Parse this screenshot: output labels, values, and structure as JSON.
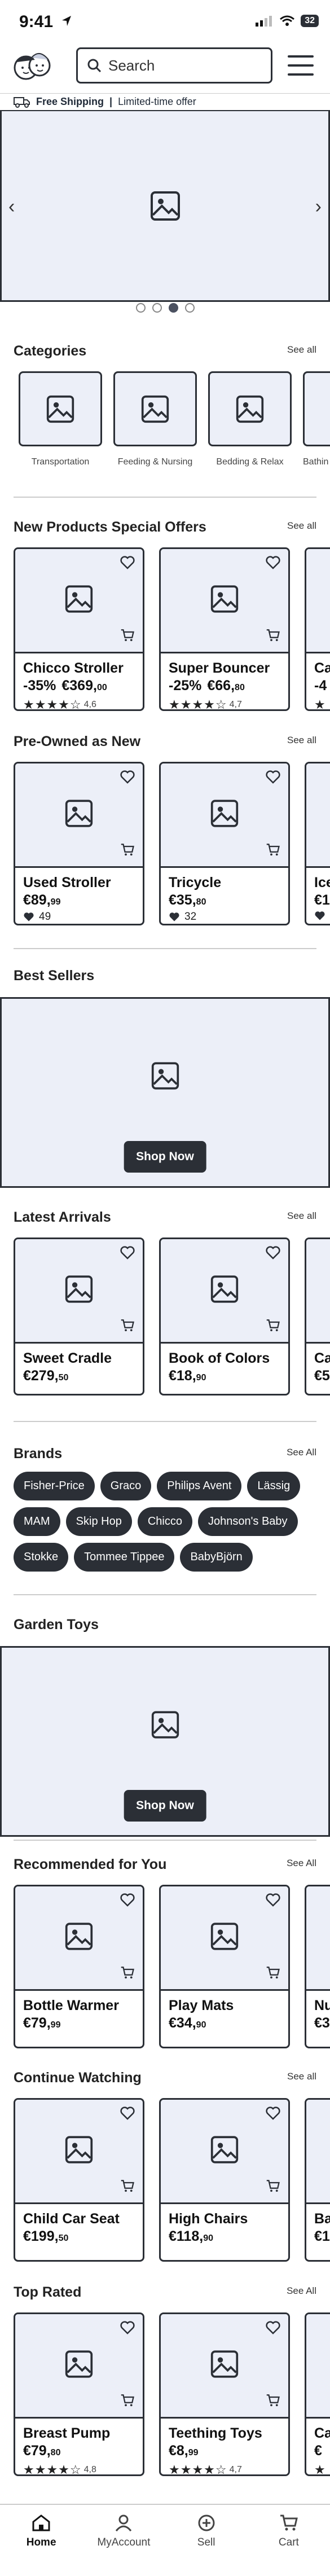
{
  "status_bar": {
    "time": "9:41",
    "battery": "32"
  },
  "header": {
    "search_placeholder": "Search"
  },
  "shipping": {
    "bold": "Free Shipping",
    "separator": "|",
    "text": "Limited-time offer"
  },
  "hero": {
    "slides_count": 4,
    "active_slide_index": 2,
    "prev": "‹",
    "next": "›"
  },
  "categories": {
    "title": "Categories",
    "see_all": "See all",
    "items": [
      {
        "label": "Transportation"
      },
      {
        "label": "Feeding & Nursing"
      },
      {
        "label": "Bedding & Relax"
      },
      {
        "label": "Bathin"
      }
    ]
  },
  "new_products": {
    "title": "New Products Special Offers",
    "see_all": "See all",
    "items": [
      {
        "name": "Chicco Stroller",
        "discount": "-35%",
        "price_main": "€369,",
        "price_cents": "00",
        "rating": "4,6",
        "stars": "★★★★☆"
      },
      {
        "name": "Super Bouncer",
        "discount": "-25%",
        "price_main": "€66,",
        "price_cents": "80",
        "rating": "4,7",
        "stars": "★★★★☆"
      },
      {
        "name": "Ca",
        "discount": "-4",
        "price_main": "",
        "price_cents": "",
        "rating": "",
        "stars": "★"
      }
    ]
  },
  "pre_owned": {
    "title": "Pre-Owned as New",
    "see_all": "See all",
    "items": [
      {
        "name": "Used Stroller",
        "price_main": "€89,",
        "price_cents": "99",
        "likes": "49"
      },
      {
        "name": "Tricycle",
        "price_main": "€35,",
        "price_cents": "80",
        "likes": "32"
      },
      {
        "name": "Ice",
        "price_main": "€1",
        "price_cents": "",
        "likes": ""
      }
    ]
  },
  "best_sellers": {
    "title": "Best Sellers",
    "cta": "Shop Now"
  },
  "latest_arrivals": {
    "title": "Latest Arrivals",
    "see_all": "See all",
    "items": [
      {
        "name": "Sweet Cradle",
        "price_main": "€279,",
        "price_cents": "50"
      },
      {
        "name": "Book of Colors",
        "price_main": "€18,",
        "price_cents": "90"
      },
      {
        "name": "Ca",
        "price_main": "€5",
        "price_cents": ""
      }
    ]
  },
  "brands": {
    "title": "Brands",
    "see_all": "See All",
    "items": [
      "Fisher-Price",
      "Graco",
      "Philips Avent",
      "Lässig",
      "MAM",
      "Skip Hop",
      "Chicco",
      "Johnson's Baby",
      "Stokke",
      "Tommee Tippee",
      "BabyBjörn"
    ]
  },
  "garden_toys": {
    "title": "Garden Toys",
    "cta": "Shop Now"
  },
  "recommended": {
    "title": "Recommended for You",
    "see_all": "See All",
    "items": [
      {
        "name": "Bottle Warmer",
        "price_main": "€79,",
        "price_cents": "99"
      },
      {
        "name": "Play Mats",
        "price_main": "€34,",
        "price_cents": "90"
      },
      {
        "name": "Nu",
        "price_main": "€3",
        "price_cents": ""
      }
    ]
  },
  "continue_watching": {
    "title": "Continue Watching",
    "see_all": "See all",
    "items": [
      {
        "name": "Child Car Seat",
        "price_main": "€199,",
        "price_cents": "50"
      },
      {
        "name": "High Chairs",
        "price_main": "€118,",
        "price_cents": "90"
      },
      {
        "name": "Ba",
        "price_main": "€1",
        "price_cents": ""
      }
    ]
  },
  "top_rated": {
    "title": "Top Rated",
    "see_all": "See All",
    "items": [
      {
        "name": "Breast Pump",
        "price_main": "€79,",
        "price_cents": "80",
        "rating": "4,8",
        "stars": "★★★★☆"
      },
      {
        "name": "Teething Toys",
        "price_main": "€8,",
        "price_cents": "99",
        "rating": "4,7",
        "stars": "★★★★☆"
      },
      {
        "name": "Ca",
        "price_main": "€",
        "price_cents": "",
        "rating": "",
        "stars": "★"
      }
    ]
  },
  "tabbar": {
    "items": [
      {
        "label": "Home"
      },
      {
        "label": "MyAccount"
      },
      {
        "label": "Sell"
      },
      {
        "label": "Cart"
      }
    ],
    "active": "Home"
  },
  "colors": {
    "dark": "#2b2f36",
    "placeholder_bg": "#eceff8"
  }
}
